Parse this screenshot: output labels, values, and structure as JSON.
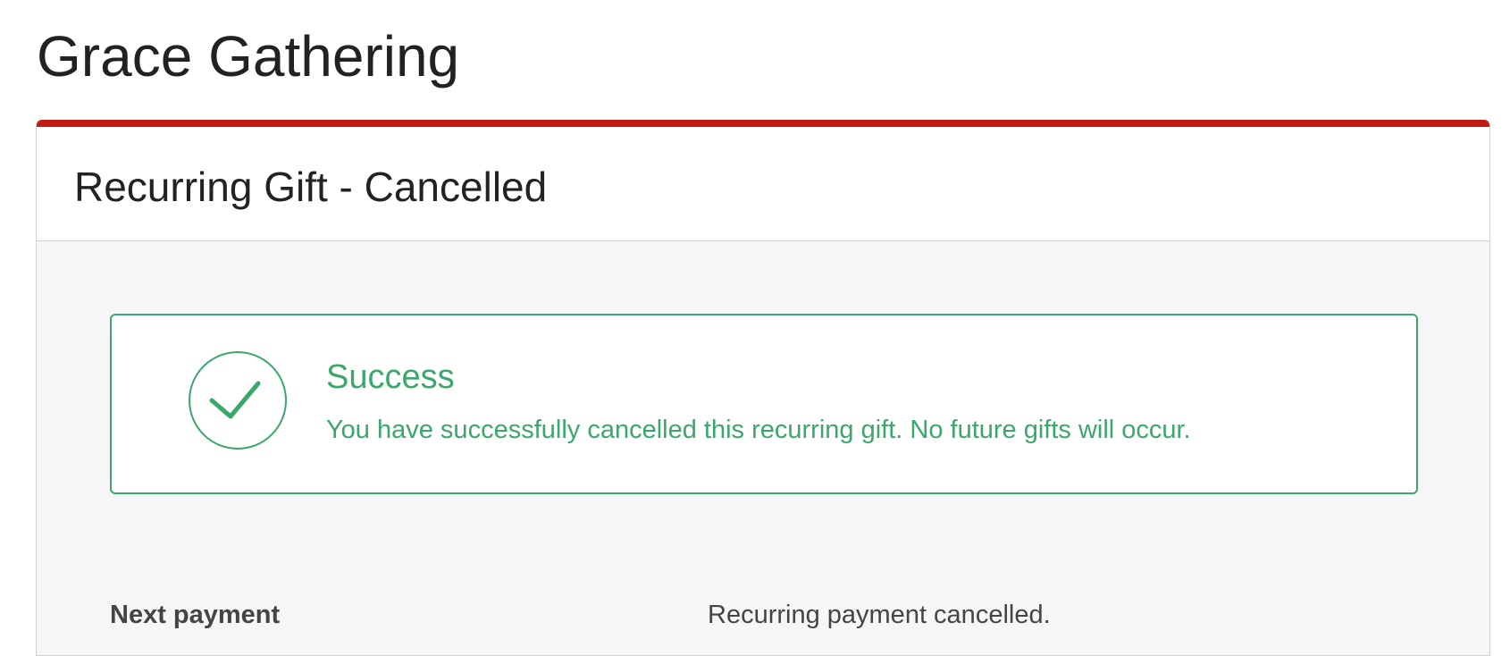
{
  "header": {
    "org_name": "Grace Gathering"
  },
  "card": {
    "title": "Recurring Gift - Cancelled",
    "accent_color": "#c41a16"
  },
  "alert": {
    "icon": "checkmark-circle-icon",
    "title": "Success",
    "message": "You have successfully cancelled this recurring gift. No future gifts will occur.",
    "color": "#3aa86b"
  },
  "details": {
    "next_payment_label": "Next payment",
    "next_payment_value": "Recurring payment cancelled."
  }
}
